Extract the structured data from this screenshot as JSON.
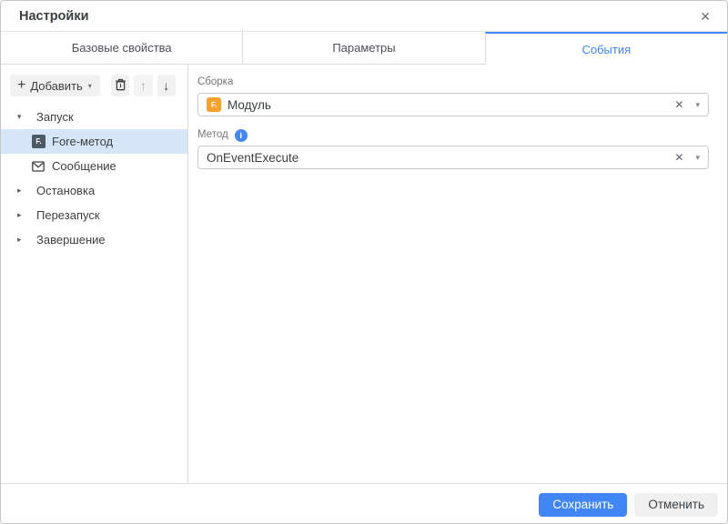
{
  "dialog": {
    "title": "Настройки",
    "close_glyph": "✕"
  },
  "tabs": [
    {
      "label": "Базовые свойства",
      "active": false
    },
    {
      "label": "Параметры",
      "active": false
    },
    {
      "label": "События",
      "active": true
    }
  ],
  "toolbar": {
    "plus_glyph": "+",
    "add_label": "Добавить",
    "caret_glyph": "▾",
    "up_glyph": "↑",
    "down_glyph": "↓"
  },
  "tree": {
    "items": [
      {
        "label": "Запуск",
        "level": 0,
        "state": "expanded",
        "expander": "▾",
        "selected": false
      },
      {
        "label": "Fore-метод",
        "level": 1,
        "icon": "fore-method-icon",
        "icon_glyph": "F.",
        "selected": true
      },
      {
        "label": "Сообщение",
        "level": 1,
        "icon": "message-icon",
        "selected": false
      },
      {
        "label": "Остановка",
        "level": 0,
        "state": "collapsed",
        "expander": "▸",
        "selected": false
      },
      {
        "label": "Перезапуск",
        "level": 0,
        "state": "collapsed",
        "expander": "▸",
        "selected": false
      },
      {
        "label": "Завершение",
        "level": 0,
        "state": "collapsed",
        "expander": "▸",
        "selected": false
      }
    ]
  },
  "form": {
    "assembly_label": "Сборка",
    "assembly_value": "Модуль",
    "module_icon_glyph": "F.",
    "method_label": "Метод",
    "info_glyph": "i",
    "method_value": "OnEventExecute",
    "clear_glyph": "✕",
    "caret_glyph": "▾"
  },
  "footer": {
    "save_label": "Сохранить",
    "cancel_label": "Отменить"
  },
  "colors": {
    "accent_blue": "#4285f4",
    "selection_bg": "#d7e5f8",
    "fore_icon_slate": "#4d5965",
    "module_icon_orange": "#f5a031",
    "info_icon_blue": "#4688f1",
    "border_gray": "#dcdcdc"
  }
}
